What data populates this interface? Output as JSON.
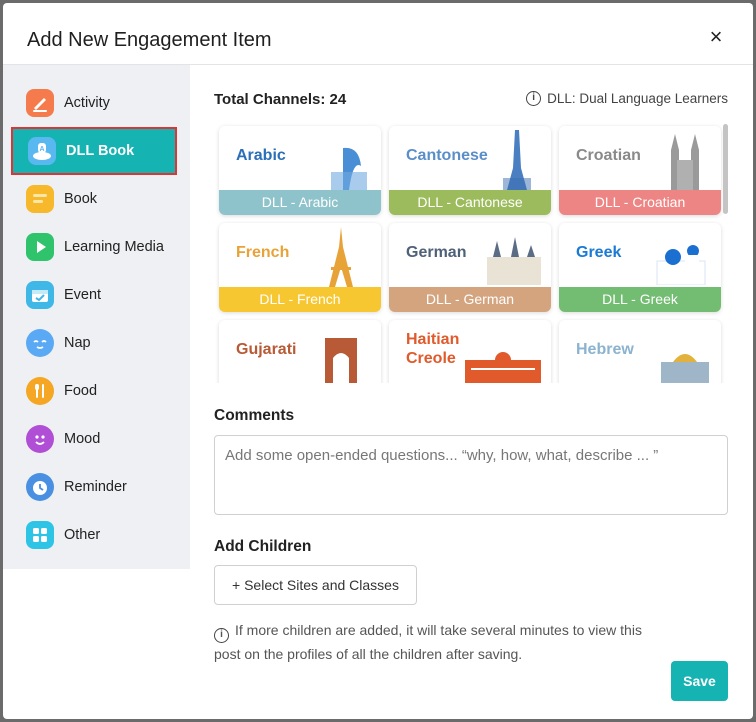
{
  "modal": {
    "title": "Add New Engagement Item",
    "close_icon": "×"
  },
  "sidebar": {
    "items": [
      {
        "label": "Activity",
        "icon": "activity-icon",
        "color": "#f57b4d"
      },
      {
        "label": "DLL Book",
        "icon": "dll-book-icon",
        "color": "#5ab8f0",
        "active": true
      },
      {
        "label": "Book",
        "icon": "book-icon",
        "color": "#f7b92b"
      },
      {
        "label": "Learning Media",
        "icon": "learning-media-icon",
        "color": "#2fc36c"
      },
      {
        "label": "Event",
        "icon": "event-icon",
        "color": "#3fb8e8"
      },
      {
        "label": "Nap",
        "icon": "nap-icon",
        "color": "#5aa9f5"
      },
      {
        "label": "Food",
        "icon": "food-icon",
        "color": "#f5a623"
      },
      {
        "label": "Mood",
        "icon": "mood-icon",
        "color": "#b04fd6"
      },
      {
        "label": "Reminder",
        "icon": "reminder-icon",
        "color": "#4a90e2"
      },
      {
        "label": "Other",
        "icon": "other-icon",
        "color": "#2ec4e6"
      }
    ]
  },
  "channels": {
    "total_label": "Total Channels: 24",
    "dll_note": "DLL: Dual Language Learners",
    "cards": [
      {
        "name": "Arabic",
        "tag": "DLL - Arabic",
        "name_color": "#2a6fb8",
        "tag_color": "#8fc3cc"
      },
      {
        "name": "Cantonese",
        "tag": "DLL - Cantonese",
        "name_color": "#5b8ec9",
        "tag_color": "#9bbb5c"
      },
      {
        "name": "Croatian",
        "tag": "DLL - Croatian",
        "name_color": "#8a8a8a",
        "tag_color": "#ee8585"
      },
      {
        "name": "French",
        "tag": "DLL - French",
        "name_color": "#e8a338",
        "tag_color": "#f7c732"
      },
      {
        "name": "German",
        "tag": "DLL - German",
        "name_color": "#4e6178",
        "tag_color": "#d4a47f"
      },
      {
        "name": "Greek",
        "tag": "DLL - Greek",
        "name_color": "#1a7ad4",
        "tag_color": "#73bd72"
      },
      {
        "name": "Gujarati",
        "tag": "",
        "name_color": "#b85a35",
        "tag_color": ""
      },
      {
        "name": "Haitian Creole",
        "tag": "",
        "name_color": "#e05a2b",
        "tag_color": ""
      },
      {
        "name": "Hebrew",
        "tag": "",
        "name_color": "#8bb3d0",
        "tag_color": ""
      }
    ]
  },
  "comments": {
    "label": "Comments",
    "placeholder": "Add some open-ended questions... “why, how, what, describe ... ”"
  },
  "children": {
    "label": "Add Children",
    "select_button": "+ Select Sites and Classes",
    "note": "If more children are added, it will take several minutes to view this post on the profiles of all the children after saving."
  },
  "footer": {
    "save_label": "Save"
  }
}
